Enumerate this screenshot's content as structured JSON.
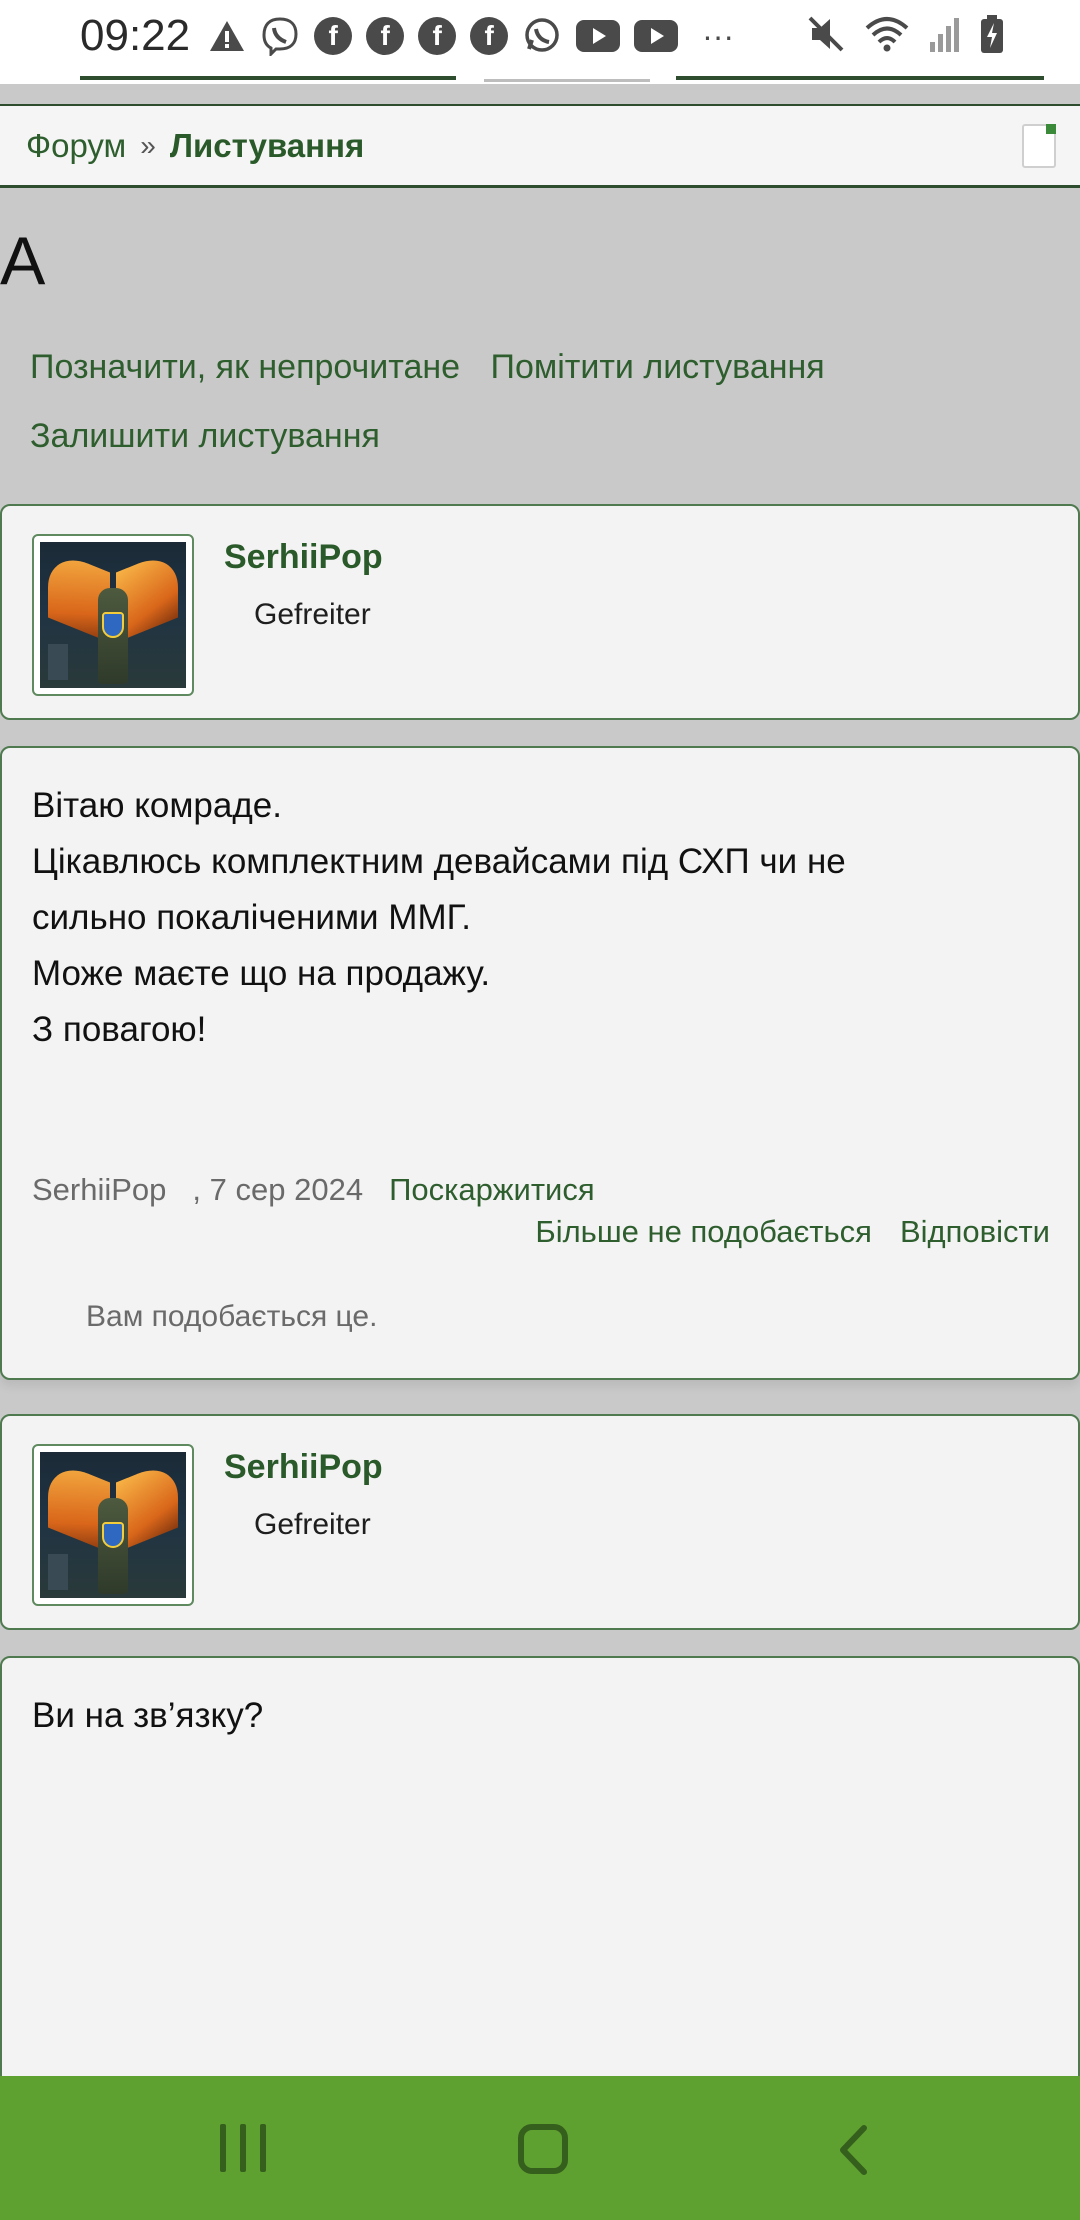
{
  "status_bar": {
    "time": "09:22",
    "icons": [
      "alert-icon",
      "viber-icon",
      "facebook-icon",
      "facebook-icon",
      "facebook-icon",
      "facebook-icon",
      "whatsapp-icon",
      "youtube-icon",
      "youtube-icon",
      "more-icon",
      "mute-icon",
      "wifi-icon",
      "signal-icon",
      "battery-icon"
    ],
    "more": "···"
  },
  "breadcrumb": {
    "forum": "Форум",
    "separator": "»",
    "current": "Листування"
  },
  "page": {
    "title": "А"
  },
  "actions": {
    "mark_unread": "Позначити, як непрочитане",
    "star": "Помітити листування",
    "leave": "Залишити листування"
  },
  "messages": [
    {
      "author": "SerhiiPop",
      "rank": "Gefreiter",
      "lines": [
        "Вітаю комраде.",
        "Цікавлюсь комплектним девайсами під СХП чи не",
        "сильно покаліченими ММГ.",
        "Може маєте що на продажу.",
        "З повагою!"
      ],
      "meta_author": "SerhiiPop",
      "date": ", 7 сер 2024",
      "report": "Поскаржитися",
      "unlike": "Більше не подобається",
      "reply": "Відповісти",
      "likes": "Вам подобається це."
    },
    {
      "author": "SerhiiPop",
      "rank": "Gefreiter",
      "lines": [
        "Ви на зв’язку?"
      ]
    }
  ],
  "colors": {
    "accent_green": "#2e5e2e",
    "border_green": "#4f7a4f",
    "nav_green": "#5fa130",
    "page_bg": "#c9c9c9"
  }
}
